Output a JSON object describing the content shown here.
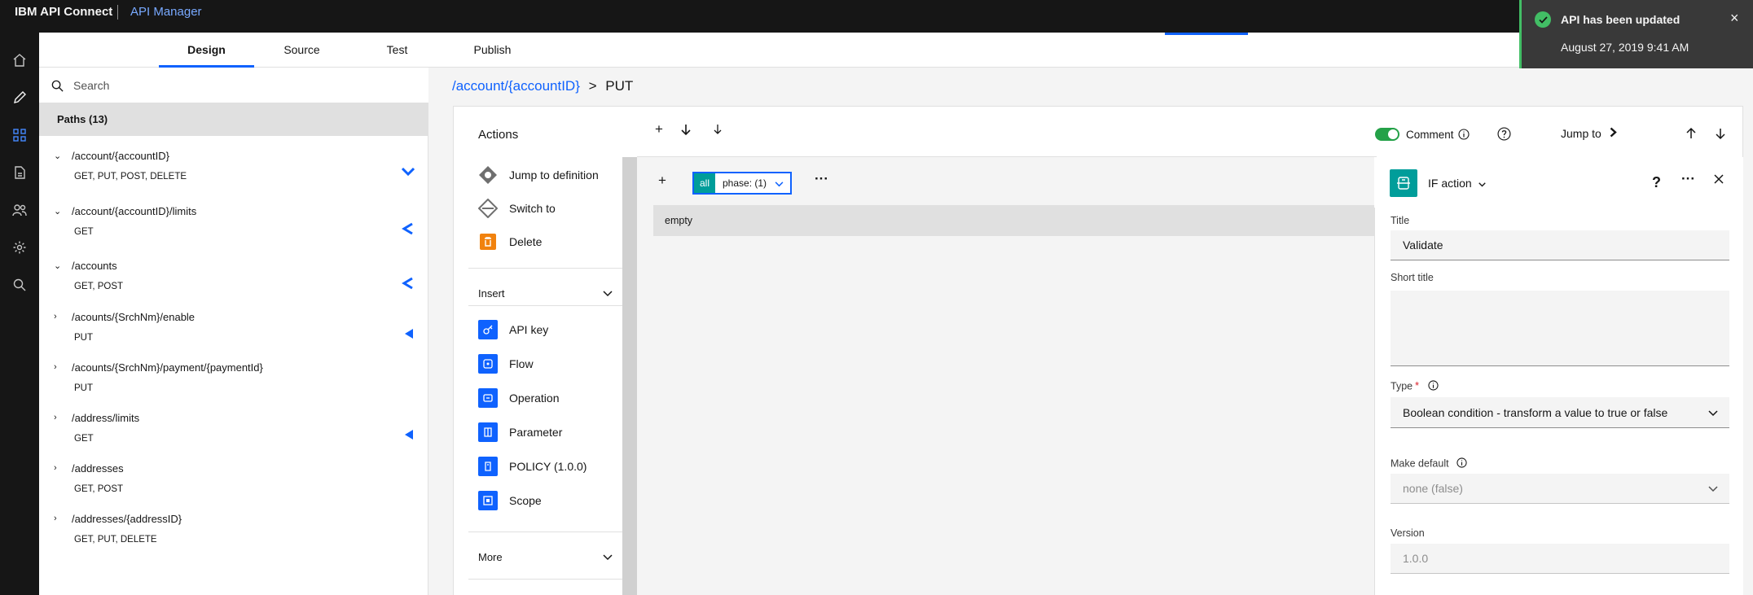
{
  "topbar": {
    "brand": "IBM API Connect",
    "app": "API Manager"
  },
  "rail": [
    "home-icon",
    "edit-icon",
    "apps-icon",
    "document-icon",
    "users-icon",
    "settings-icon",
    "search-icon"
  ],
  "tabs": [
    "Design",
    "Source",
    "Test",
    "Publish"
  ],
  "search": {
    "placeholder": "Search"
  },
  "paths": {
    "header": "Paths (13)",
    "items": [
      {
        "path": "/account/{accountID}",
        "methods": "GET, PUT, POST, DELETE",
        "expanded": true
      },
      {
        "path": "/account/{accountID}/limits",
        "methods": "GET",
        "expanded": true
      },
      {
        "path": "/accounts",
        "methods": "GET, POST",
        "expanded": true
      },
      {
        "path": "/acounts/{SrchNm}/enable",
        "methods": "PUT",
        "expanded": false
      },
      {
        "path": "/acounts/{SrchNm}/payment/{paymentId}",
        "methods": "PUT",
        "expanded": false
      },
      {
        "path": "/address/limits",
        "methods": "GET",
        "expanded": false
      },
      {
        "path": "/addresses",
        "methods": "GET, POST",
        "expanded": false
      },
      {
        "path": "/addresses/{addressID}",
        "methods": "GET, PUT, DELETE",
        "expanded": false
      }
    ]
  },
  "breadcrumb": {
    "link": "/account/{accountID}",
    "separator": ">",
    "current": "PUT"
  },
  "actions": {
    "title": "Actions",
    "items": [
      "Jump to definition",
      "Switch to",
      "Delete"
    ],
    "insert_label": "Insert",
    "insert_items": [
      "API key",
      "Flow",
      "Operation",
      "Parameter",
      "POLICY (1.0.0)",
      "Scope"
    ],
    "more_label": "More"
  },
  "canvas": {
    "phase_all": "all",
    "phase_label": "phase: (1)",
    "empty_label": "empty"
  },
  "toolbar": {
    "comment": "Comment",
    "jump_to": "Jump to"
  },
  "props": {
    "header": "IF action",
    "title_label": "Title",
    "title_value": "Validate",
    "short_title_label": "Short title",
    "type_label": "Type",
    "type_value": "Boolean condition - transform a value to true or false",
    "make_default_label": "Make default",
    "make_default_value": "none (false)",
    "version_label": "Version",
    "version_value": "1.0.0"
  },
  "notification": {
    "title": "API has been updated",
    "subtitle": "August 27, 2019 9:41 AM"
  },
  "colors": {
    "accent": "#0f62fe",
    "teal": "#009d9a",
    "success": "#42be65",
    "orange": "#f1820e"
  }
}
